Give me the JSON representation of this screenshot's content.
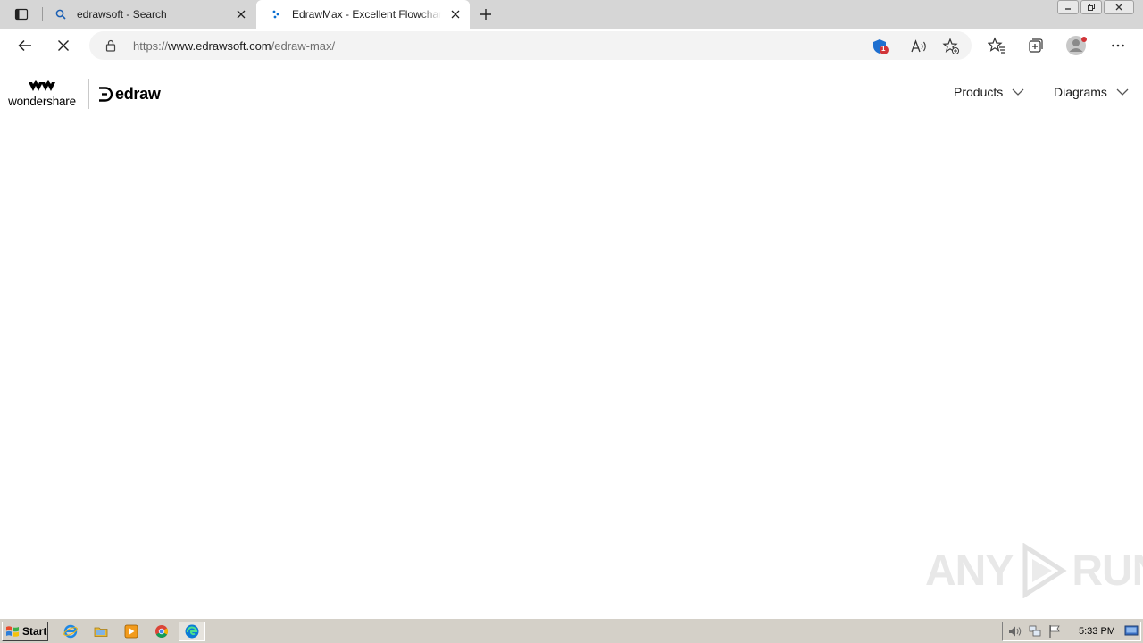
{
  "browser": {
    "tabs": [
      {
        "title": "edrawsoft - Search",
        "active": false,
        "favicon": "search-icon"
      },
      {
        "title": "EdrawMax - Excellent Flowchart Software",
        "active": true,
        "favicon": "edraw-favicon"
      }
    ],
    "address": {
      "prefix": "https://",
      "host": "www.edrawsoft.com",
      "path": "/edraw-max/"
    },
    "extension_badge": "1",
    "colors": {
      "tabstrip": "#d6d6d6",
      "omnibox": "#f3f3f3",
      "accent": "#0067c0"
    }
  },
  "page": {
    "brand": {
      "wondershare": "wondershare",
      "edraw": "edraw"
    },
    "nav": [
      {
        "label": "Products"
      },
      {
        "label": "Diagrams"
      }
    ],
    "watermark": {
      "left": "ANY",
      "right": "RUN"
    }
  },
  "taskbar": {
    "start_label": "Start",
    "clock": "5:33 PM"
  }
}
